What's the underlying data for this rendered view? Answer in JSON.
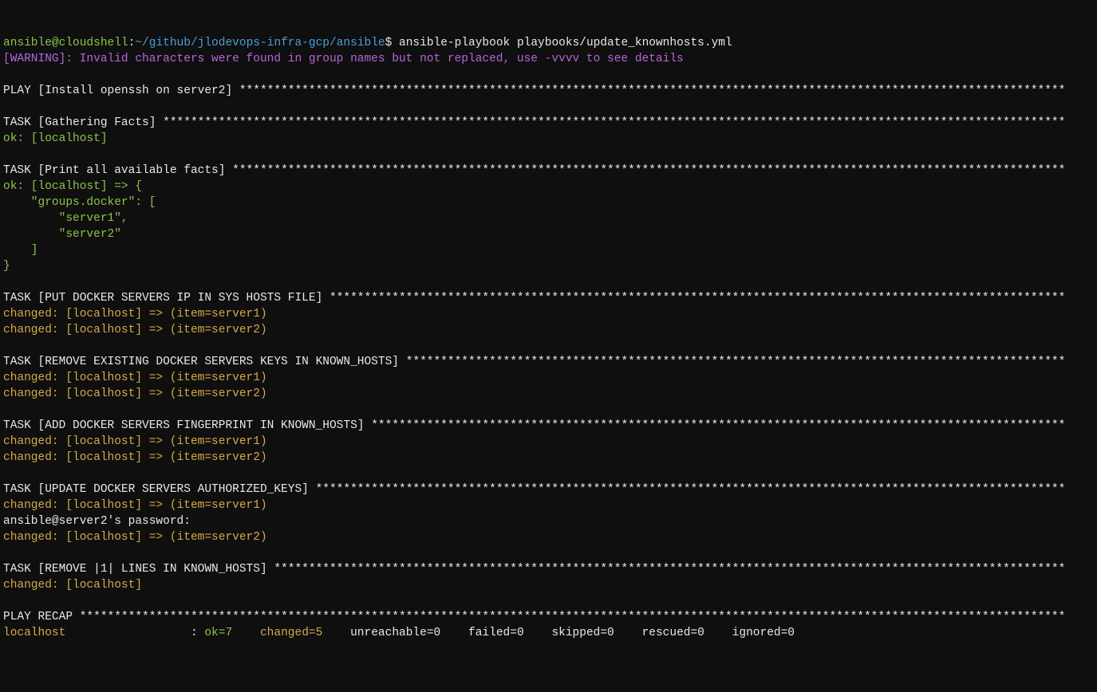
{
  "prompt": {
    "user_host": "ansible@cloudshell",
    "colon": ":",
    "path": "~/github/jlodevops-infra-gcp/ansible",
    "dollar": "$",
    "command": " ansible-playbook playbooks/update_knownhosts.yml"
  },
  "warning": {
    "tag": "[WARNING]: ",
    "msg": "Invalid characters were found in group names but not replaced, use -vvvv to see details"
  },
  "play_header": "PLAY [Install openssh on server2] ",
  "task_gather": "TASK [Gathering Facts] ",
  "ok_localhost": "ok: [localhost]",
  "task_print": "TASK [Print all available facts] ",
  "facts": {
    "l1": "ok: [localhost] => {",
    "l2": "    \"groups.docker\": [",
    "l3": "        \"server1\",",
    "l4": "        \"server2\"",
    "l5": "    ]",
    "l6": "}"
  },
  "task_put": "TASK [PUT DOCKER SERVERS IP IN SYS HOSTS FILE] ",
  "changed_s1": "changed: [localhost] => (item=server1)",
  "changed_s2": "changed: [localhost] => (item=server2)",
  "task_remove": "TASK [REMOVE EXISTING DOCKER SERVERS KEYS IN KNOWN_HOSTS] ",
  "task_add": "TASK [ADD DOCKER SERVERS FINGERPRINT IN KNOWN_HOSTS] ",
  "task_auth": "TASK [UPDATE DOCKER SERVERS AUTHORIZED_KEYS] ",
  "pw_prompt": "ansible@server2's password:",
  "task_remove_lines": "TASK [REMOVE |1| LINES IN KNOWN_HOSTS] ",
  "changed_plain": "changed: [localhost]",
  "recap_header": "PLAY RECAP ",
  "recap": {
    "host": "localhost                  ",
    "colon": ": ",
    "ok": "ok=7   ",
    "changed": " changed=5   ",
    "rest": " unreachable=0    failed=0    skipped=0    rescued=0    ignored=0"
  }
}
